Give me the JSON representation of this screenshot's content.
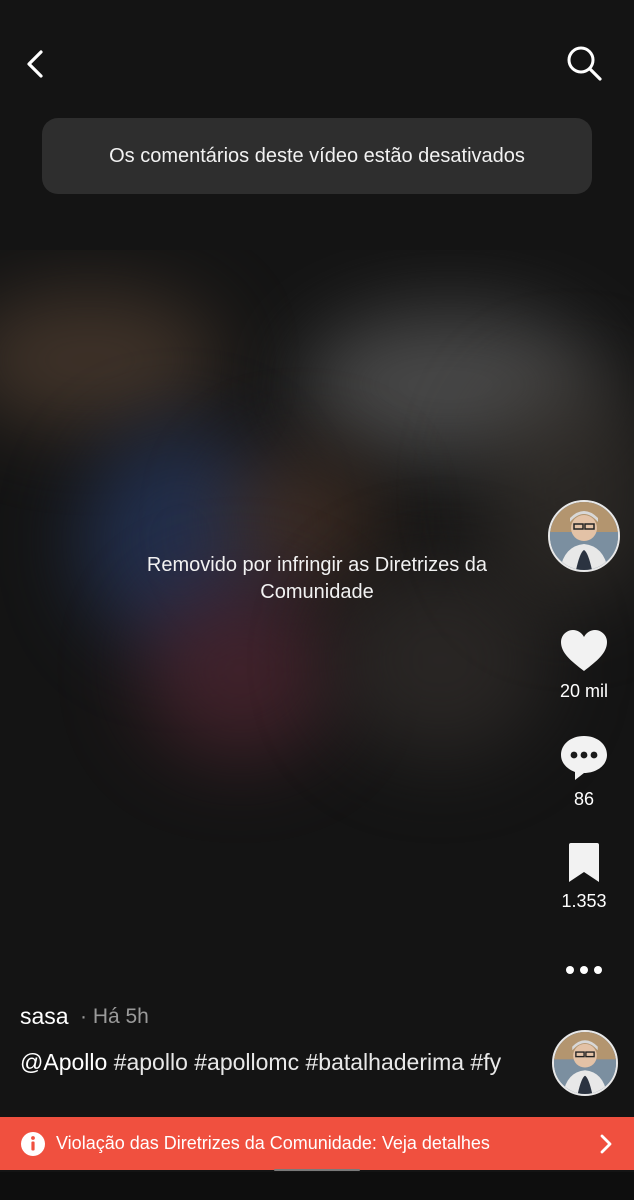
{
  "toast": {
    "text": "Os comentários deste vídeo estão desativados"
  },
  "video": {
    "removed_text": "Removido por infringir as Diretrizes da Comunidade"
  },
  "actions": {
    "like_count": "20 mil",
    "comment_count": "86",
    "save_count": "1.353"
  },
  "post": {
    "username": "sasa",
    "time": "· Há 5h",
    "caption_mention": "@Apollo",
    "caption_tags": "#apollo #apollomc #batalhaderima #fy"
  },
  "banner": {
    "text": "Violação das Diretrizes da Comunidade: Veja detalhes",
    "color": "#f0503f"
  },
  "icons": [
    "back-icon",
    "search-icon",
    "heart-icon",
    "comment-icon",
    "bookmark-icon",
    "more-icon",
    "info-icon",
    "chevron-right-icon"
  ]
}
